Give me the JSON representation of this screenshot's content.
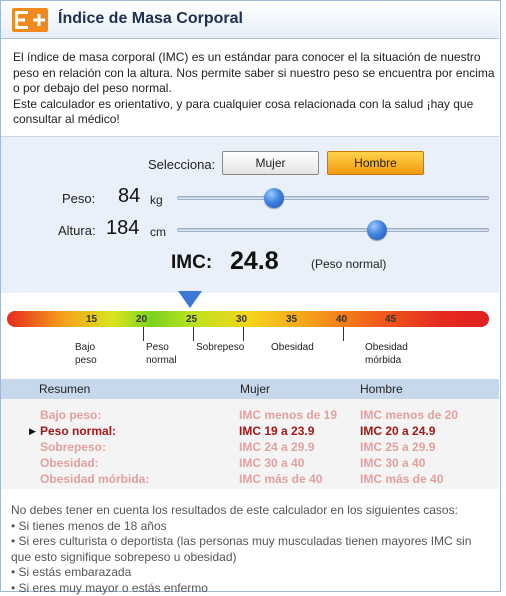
{
  "header": {
    "title": "Índice de Masa Corporal"
  },
  "intro": {
    "p1": "El índice de masa corporal (IMC) es un estándar para conocer el la situación de nuestro peso en relación con la altura. Nos permite saber si nuestro peso se encuentra por encima o por debajo del peso normal.",
    "p2": "Este calculador es orientativo, y para cualquier cosa relacionada con la salud ¡hay que consultar al médico!"
  },
  "selector": {
    "label": "Selecciona:",
    "options": [
      "Mujer",
      "Hombre"
    ],
    "selected": "Hombre"
  },
  "weight": {
    "label": "Peso:",
    "value": "84",
    "unit": "kg",
    "slider_fraction": 0.31
  },
  "height": {
    "label": "Altura:",
    "value": "184",
    "unit": "cm",
    "slider_fraction": 0.64
  },
  "result": {
    "label": "IMC:",
    "value": "24.8",
    "status": "(Peso normal)"
  },
  "scale": {
    "numbers": [
      "15",
      "20",
      "25",
      "30",
      "35",
      "40",
      "45"
    ],
    "categories": [
      {
        "l1": "Bajo",
        "l2": "peso"
      },
      {
        "l1": "Peso",
        "l2": "normal"
      },
      {
        "l1": "Sobrepeso",
        "l2": ""
      },
      {
        "l1": "Obesidad",
        "l2": ""
      },
      {
        "l1": "Obesidad",
        "l2": "mórbida"
      }
    ],
    "colors": {
      "low": "#e52b1e",
      "normal": "#7ad21e",
      "high": "#e02020"
    }
  },
  "summary": {
    "headers": [
      "Resumen",
      "Mujer",
      "Hombre"
    ],
    "rows": [
      {
        "category": "Bajo peso:",
        "mujer": "IMC menos de 19",
        "hombre": "IMC menos de 20"
      },
      {
        "category": "Peso normal:",
        "mujer": "IMC 19 a 23.9",
        "hombre": "IMC 20 a 24.9"
      },
      {
        "category": "Sobrepeso:",
        "mujer": "IMC 24 a 29.9",
        "hombre": "IMC 25 a 29.9"
      },
      {
        "category": "Obesidad:",
        "mujer": "IMC 30 a 40",
        "hombre": "IMC 30 a 40"
      },
      {
        "category": "Obesidad mórbida:",
        "mujer": "IMC más de 40",
        "hombre": "IMC más de 40"
      }
    ],
    "current_marker": "▶"
  },
  "notes": {
    "intro": "No debes tener en cuenta los resultados de este calculador en los siguientes casos:",
    "items": [
      "• Si tienes menos de 18 años",
      "• Si eres culturista o deportista (las personas muy musculadas tienen mayores IMC sin",
      "que esto signifique sobrepeso u obesidad)",
      "• Si estás embarazada",
      "• Si eres muy mayor o estás enfermo"
    ]
  },
  "colors": {
    "accent_orange": "#f39a10",
    "slider_knob": "#3f84e0",
    "highlight_red": "#a31818",
    "muted_red": "#e3a0a0"
  }
}
